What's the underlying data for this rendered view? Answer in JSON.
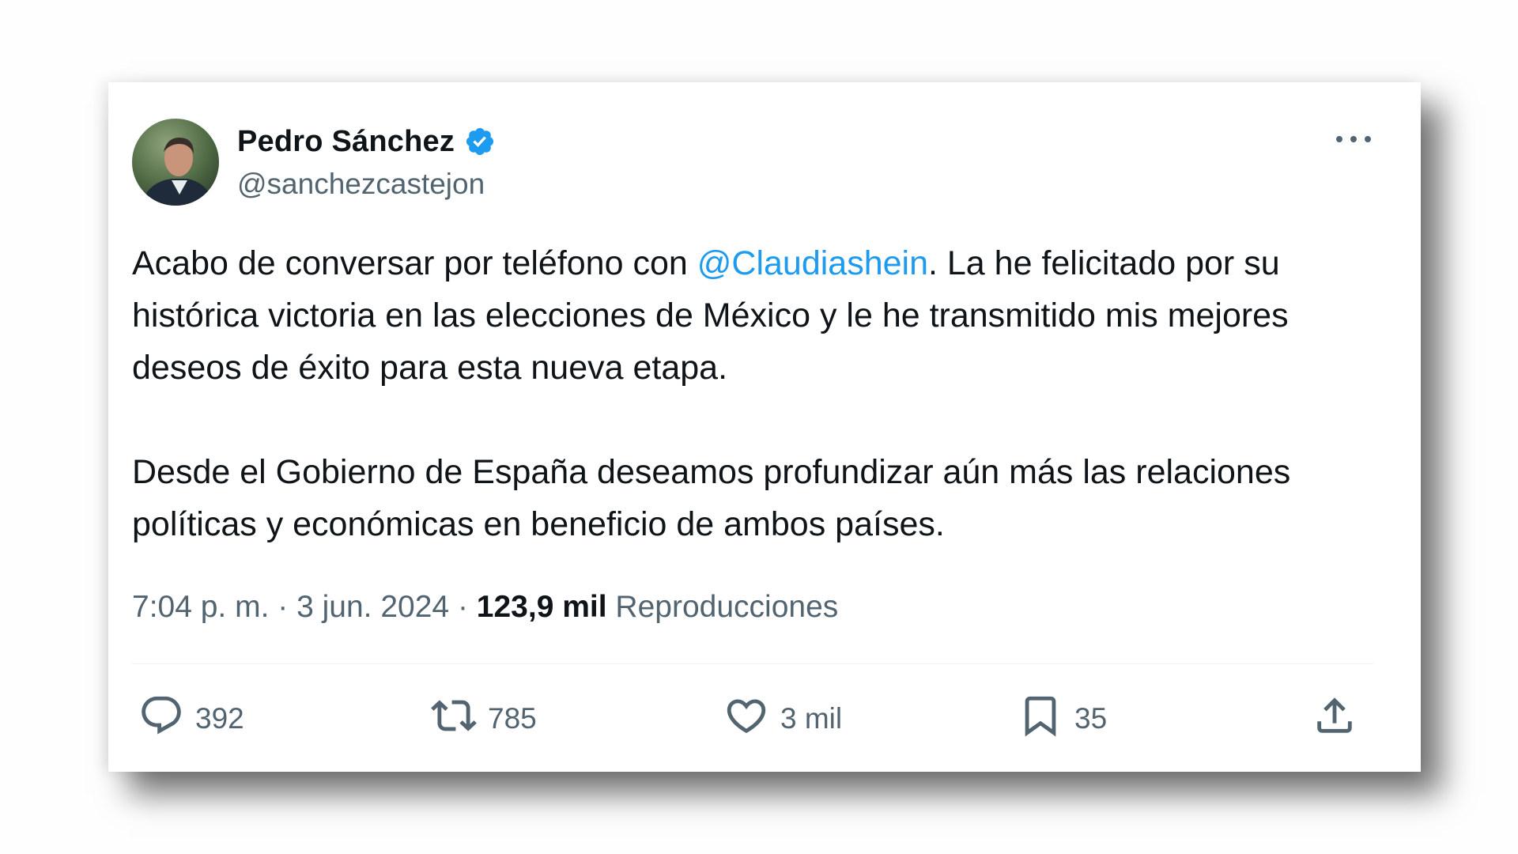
{
  "author": {
    "display_name": "Pedro Sánchez",
    "handle": "@sanchezcastejon",
    "verified": true
  },
  "tweet": {
    "paragraph1_before": "Acabo de conversar por teléfono con ",
    "mention": "@Claudiashein",
    "paragraph1_after": ". La he felicitado por su histórica victoria en las elecciones de México y le he transmitido mis mejores deseos de éxito para esta nueva etapa.",
    "paragraph2": "Desde el Gobierno de España deseamos profundizar aún más las relaciones políticas y económicas en beneficio de ambos países."
  },
  "meta": {
    "time": "7:04 p. m.",
    "separator": " · ",
    "date": "3 jun. 2024",
    "views_count": "123,9 mil",
    "views_label": "Reproducciones"
  },
  "actions": {
    "replies": "392",
    "reposts": "785",
    "likes": "3 mil",
    "bookmarks": "35"
  },
  "colors": {
    "text": "#0f1419",
    "secondary": "#536471",
    "link": "#1d9bf0",
    "verified_badge": "#1d9bf0"
  },
  "icons": [
    "verified-badge-icon",
    "more-icon",
    "reply-icon",
    "repost-icon",
    "like-icon",
    "bookmark-icon",
    "share-icon"
  ]
}
